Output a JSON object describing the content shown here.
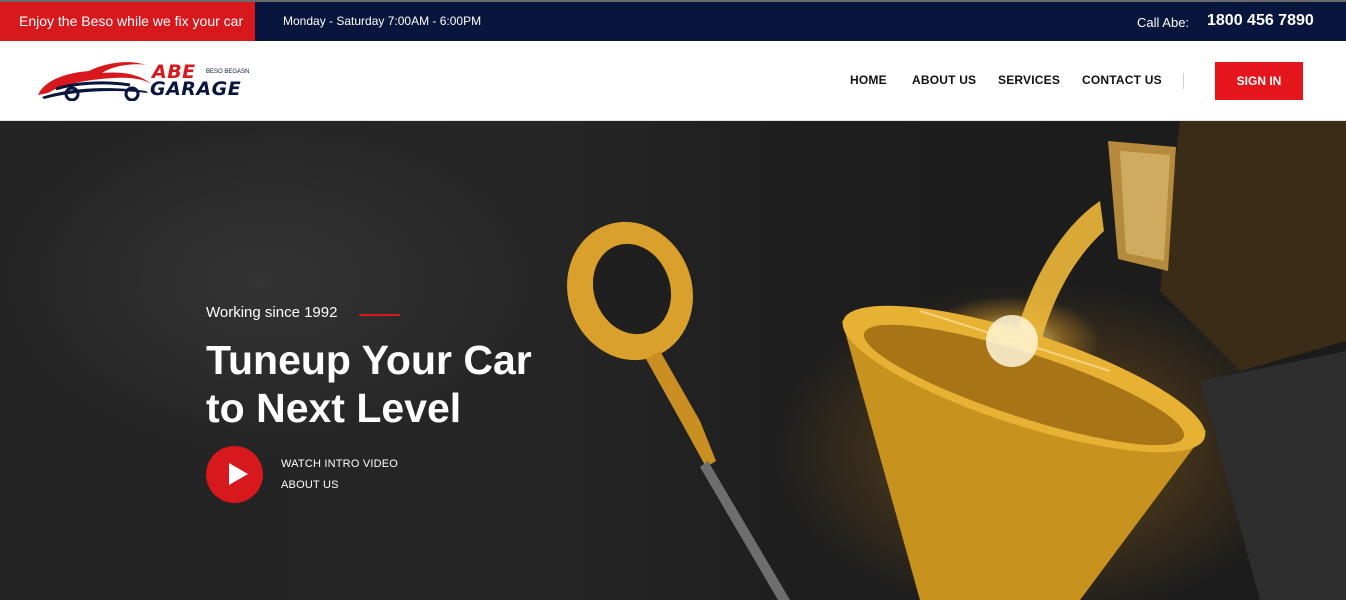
{
  "topbar": {
    "promo": "Enjoy the Beso while we fix your car",
    "hours": "Monday - Saturday 7:00AM - 6:00PM",
    "call_label": "Call Abe:",
    "phone": "1800 456 7890"
  },
  "logo": {
    "line1": "ABE",
    "line2": "GARAGE",
    "tagline": "BESO BEGASN"
  },
  "nav": {
    "items": [
      {
        "label": "HOME"
      },
      {
        "label": "ABOUT US"
      },
      {
        "label": "SERVICES"
      },
      {
        "label": "CONTACT US"
      }
    ],
    "signin": "SIGN IN"
  },
  "hero": {
    "since": "Working since 1992",
    "headline_line1": "Tuneup Your Car",
    "headline_line2": "to Next Level",
    "watch_link": "WATCH INTRO VIDEO",
    "about_link": "ABOUT US"
  },
  "colors": {
    "brand_red": "#d7181c",
    "navy": "#08163d",
    "hero_dark": "#232323",
    "oil_gold": "#e0a52a"
  },
  "icons": [
    "car-logo-icon",
    "play-icon"
  ]
}
